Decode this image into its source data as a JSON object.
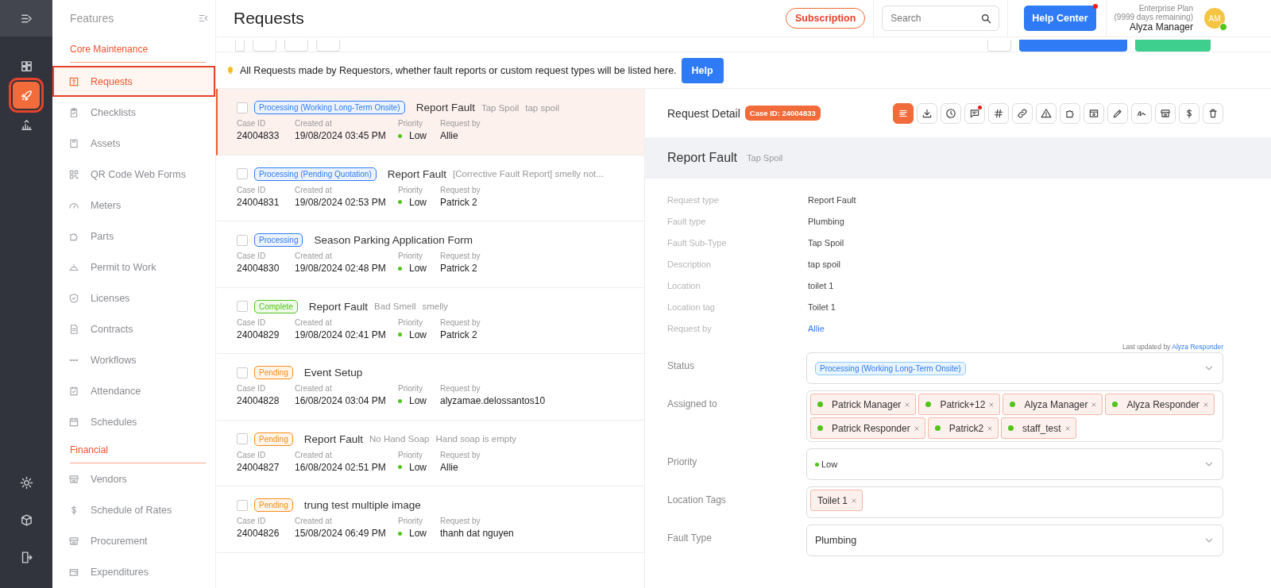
{
  "rail": {
    "items": [
      {
        "selected": false
      },
      {
        "selected": true
      },
      {
        "selected": false
      }
    ]
  },
  "sidebar": {
    "title": "Features",
    "sections": [
      {
        "title": "Core Maintenance",
        "items": [
          {
            "label": "Requests",
            "selected": true
          },
          {
            "label": "Checklists",
            "selected": false
          },
          {
            "label": "Assets",
            "selected": false
          },
          {
            "label": "QR Code Web Forms",
            "selected": false
          },
          {
            "label": "Meters",
            "selected": false
          },
          {
            "label": "Parts",
            "selected": false
          },
          {
            "label": "Permit to Work",
            "selected": false
          },
          {
            "label": "Licenses",
            "selected": false
          },
          {
            "label": "Contracts",
            "selected": false
          },
          {
            "label": "Workflows",
            "selected": false
          },
          {
            "label": "Attendance",
            "selected": false
          },
          {
            "label": "Schedules",
            "selected": false
          }
        ]
      },
      {
        "title": "Financial",
        "items": [
          {
            "label": "Vendors",
            "selected": false
          },
          {
            "label": "Schedule of Rates",
            "selected": false
          },
          {
            "label": "Procurement",
            "selected": false
          },
          {
            "label": "Expenditures",
            "selected": false
          }
        ]
      }
    ]
  },
  "header": {
    "title": "Requests",
    "subscription": "Subscription",
    "search": {
      "placeholder": "Search"
    },
    "help_center": {
      "label": "Help Center",
      "notification": true
    },
    "plan": "Enterprise Plan",
    "plan_days": "(9999 days remaining)",
    "user": "Alyza Manager",
    "avatar": "AM",
    "online": true
  },
  "toolbar": {
    "checked": false
  },
  "notice": {
    "text": "All Requests made by Requestors, whether fault reports or custom request types will be listed here.",
    "button": "Help"
  },
  "requests": [
    {
      "selected": true,
      "checked": false,
      "status": "Processing (Working Long-Term Onsite)",
      "color": "#2f7bf5",
      "title": "Report Fault",
      "notes": [
        "Tap Spoil",
        "tap spoil"
      ],
      "fields": [
        {
          "label": "Case ID",
          "value": "24004833"
        },
        {
          "label": "Created at",
          "value": "19/08/2024 03:45 PM"
        },
        {
          "label": "Priority",
          "value": "Low",
          "kind": "priority"
        },
        {
          "label": "Request by",
          "value": "Allie"
        }
      ]
    },
    {
      "selected": false,
      "checked": false,
      "status": "Processing (Pending Quotation)",
      "color": "#2f7bf5",
      "title": "Report Fault",
      "notes": [
        "[Corrective Fault Report] smelly not..."
      ],
      "fields": [
        {
          "label": "Case ID",
          "value": "24004831"
        },
        {
          "label": "Created at",
          "value": "19/08/2024 02:53 PM"
        },
        {
          "label": "Priority",
          "value": "Low",
          "kind": "priority"
        },
        {
          "label": "Request by",
          "value": "Patrick 2"
        }
      ]
    },
    {
      "selected": false,
      "checked": false,
      "status": "Processing",
      "color": "#2f7bf5",
      "title": "Season Parking Application Form",
      "fields": [
        {
          "label": "Case ID",
          "value": "24004830"
        },
        {
          "label": "Created at",
          "value": "19/08/2024 02:48 PM"
        },
        {
          "label": "Priority",
          "value": "Low",
          "kind": "priority"
        },
        {
          "label": "Request by",
          "value": "Patrick 2"
        }
      ]
    },
    {
      "selected": false,
      "checked": false,
      "status": "Complete",
      "color": "#52c41a",
      "title": "Report Fault",
      "notes": [
        "Bad Smell",
        "smelly"
      ],
      "fields": [
        {
          "label": "Case ID",
          "value": "24004829"
        },
        {
          "label": "Created at",
          "value": "19/08/2024 02:41 PM"
        },
        {
          "label": "Priority",
          "value": "Low",
          "kind": "priority"
        },
        {
          "label": "Request by",
          "value": "Patrick 2"
        }
      ]
    },
    {
      "selected": false,
      "checked": false,
      "status": "Pending",
      "color": "#fa8c16",
      "title": "Event Setup",
      "fields": [
        {
          "label": "Case ID",
          "value": "24004828"
        },
        {
          "label": "Created at",
          "value": "16/08/2024 03:04 PM"
        },
        {
          "label": "Priority",
          "value": "Low",
          "kind": "priority"
        },
        {
          "label": "Request by",
          "value": "alyzamae.delossantos10"
        }
      ]
    },
    {
      "selected": false,
      "checked": false,
      "status": "Pending",
      "color": "#fa8c16",
      "title": "Report Fault",
      "notes": [
        "No Hand Soap",
        "Hand soap is empty"
      ],
      "fields": [
        {
          "label": "Case ID",
          "value": "24004827"
        },
        {
          "label": "Created at",
          "value": "16/08/2024 02:51 PM"
        },
        {
          "label": "Priority",
          "value": "Low",
          "kind": "priority"
        },
        {
          "label": "Request by",
          "value": "Allie"
        }
      ]
    },
    {
      "selected": false,
      "checked": false,
      "status": "Pending",
      "color": "#fa8c16",
      "title": "trung test multiple image",
      "fields": [
        {
          "label": "Case ID",
          "value": "24004826"
        },
        {
          "label": "Created at",
          "value": "15/08/2024 06:49 PM"
        },
        {
          "label": "Priority",
          "value": "Low",
          "kind": "priority"
        },
        {
          "label": "Request by",
          "value": "thanh dat nguyen"
        }
      ]
    }
  ],
  "detail": {
    "title": "Request Detail",
    "case_badge": "Case ID: 24004833",
    "tools": [
      {
        "selected": true,
        "notification": false
      },
      {
        "selected": false,
        "notification": false
      },
      {
        "selected": false,
        "notification": false
      },
      {
        "selected": false,
        "notification": true
      },
      {
        "selected": false,
        "notification": false
      },
      {
        "selected": false,
        "notification": false
      },
      {
        "selected": false,
        "notification": false
      },
      {
        "selected": false,
        "notification": false
      },
      {
        "selected": false,
        "notification": false
      },
      {
        "selected": false,
        "notification": false
      },
      {
        "selected": false,
        "notification": false
      },
      {
        "selected": false,
        "notification": false
      },
      {
        "selected": false,
        "notification": false
      },
      {
        "selected": false,
        "notification": false
      }
    ],
    "summary": {
      "title": "Report Fault",
      "subtitle": "Tap Spoil"
    },
    "info": [
      {
        "label": "Request type",
        "value": "Report Fault"
      },
      {
        "label": "Fault type",
        "value": "Plumbing"
      },
      {
        "label": "Fault Sub-Type",
        "value": "Tap Spoil"
      },
      {
        "label": "Description",
        "value": "tap spoil"
      },
      {
        "label": "Location",
        "value": "toilet 1"
      },
      {
        "label": "Location tag",
        "value": "Toilet 1"
      },
      {
        "label": "Request by",
        "value": "Allie",
        "kind": "link"
      }
    ],
    "last_updated": {
      "text": "Last updated by",
      "user": "Alyza Responder"
    },
    "form": [
      {
        "label": "Status",
        "kind": "status",
        "value": "Processing (Working Long-Term Onsite)"
      },
      {
        "label": "Assigned to",
        "kind": "people",
        "tags": [
          "Patrick Manager",
          "Patrick+12",
          "Alyza Manager",
          "Alyza Responder",
          "Patrick Responder",
          "Patrick2",
          "staff_test"
        ]
      },
      {
        "label": "Priority",
        "kind": "priority",
        "value": "Low"
      },
      {
        "label": "Location Tags",
        "kind": "tags",
        "tags": [
          "Toilet 1"
        ]
      },
      {
        "label": "Fault Type",
        "kind": "select",
        "value": "Plumbing"
      }
    ]
  }
}
